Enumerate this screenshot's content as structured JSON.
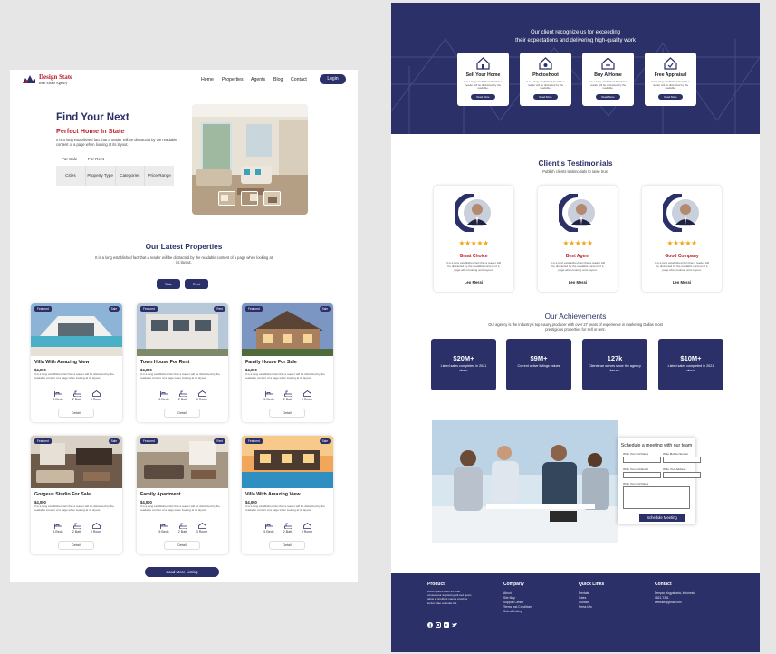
{
  "header": {
    "brand": "Design State",
    "brand_sub": "Real Estate Agency",
    "nav": [
      "Home",
      "Properties",
      "Agents",
      "Blog",
      "Contact"
    ],
    "login": "Login"
  },
  "hero": {
    "title": "Find Your Next",
    "subtitle": "Perfect Home In State",
    "desc": "It is a long established fact that a reader will be distracted by the readable content of a page when looking at its layout.",
    "tabs": [
      "For Sale",
      "For Rent"
    ],
    "filters": [
      "Cities",
      "Property Type",
      "Categories",
      "Price Range"
    ]
  },
  "latest": {
    "title": "Our Latest Properties",
    "desc": "It is a long established fact that a reader will be distracted by the readable content of a page when looking at its layout.",
    "buttons": [
      "Sale",
      "Rent"
    ],
    "load_more": "Load More Listing"
  },
  "cards": [
    {
      "title": "Villa With Amazing View",
      "price": "$4,000",
      "badge": "Featured",
      "tag": "Sale"
    },
    {
      "title": "Town House For Rent",
      "price": "$4,000",
      "badge": "Featured",
      "tag": "Rent"
    },
    {
      "title": "Family House For Sale",
      "price": "$4,000",
      "badge": "Featured",
      "tag": "Sale"
    },
    {
      "title": "Gorgeus Studio For Sale",
      "price": "$4,000",
      "badge": "Featured",
      "tag": "Sale"
    },
    {
      "title": "Family Apartment",
      "price": "$4,000",
      "badge": "Featured",
      "tag": "Rent"
    },
    {
      "title": "Villa With Amazing View",
      "price": "$4,000",
      "badge": "Featured",
      "tag": "Sale"
    }
  ],
  "card_common": {
    "desc": "It is a long established fact that a reader will be distracted by the readable content of a page when looking at its layout.",
    "beds": "5 Beds",
    "bath": "2 Bath",
    "room": "3 Room",
    "detail": "Detail"
  },
  "services": {
    "title_line1": "Our client recognize us for exceeding",
    "title_line2": "their expectations and delivering high-quality work",
    "items": [
      "Sell Your Home",
      "Photoshoot",
      "Buy A Home",
      "Free Appraisal"
    ],
    "desc": "It is a long established fact that a reader will be distracted by the readable.",
    "button": "Read More"
  },
  "testimonials": {
    "title": "Client's Testimonials",
    "subtitle": "Publish clients testimonials to raise trust",
    "items": [
      {
        "title": "Great Choice",
        "name": "Leo Messi"
      },
      {
        "title": "Best Agent",
        "name": "Leo Messi"
      },
      {
        "title": "Good Company",
        "name": "Leo Messi"
      }
    ],
    "desc": "It is a long established fact that a reader will be distracted by the readable content of a page when looking at its layout.",
    "stars": "★★★★★",
    "rating": 5
  },
  "achievements": {
    "title": "Our Achievements",
    "desc": "Our agency is the industry's top luxury producer with over 27 years of experience in marketing Dallas most prestigious properties for sell or rent.",
    "items": [
      {
        "value": "$20M+",
        "label": "Listed sales completed in 2021 alone"
      },
      {
        "value": "$9M+",
        "label": "Current active listings values"
      },
      {
        "value": "127k",
        "label": "Clients we serves since the agency launch"
      },
      {
        "value": "$10M+",
        "label": "Listed sales completed in 2021 alone"
      }
    ]
  },
  "meeting": {
    "title": "Schedule a meeting with our team",
    "labels": [
      "Write Your Full Name",
      "Write Mobile Number",
      "Write Your Full Email",
      "Write Your Address",
      "Write Your Full Name"
    ],
    "button": "Schedule Meeting"
  },
  "footer": {
    "product": {
      "title": "Product",
      "text": "Lorem ipsum dolor sit amet consectetur adipiscing elit sed quam tellus et tincidunt mauris a lacinia lectus vitae vehicula nisl."
    },
    "company": {
      "title": "Company",
      "items": [
        "About",
        "Site Map",
        "Support Center",
        "Terms and Conditions",
        "Submit Listing"
      ]
    },
    "quick": {
      "title": "Quick Links",
      "items": [
        "Rentals",
        "Sales",
        "Contact",
        "Press Info"
      ]
    },
    "contact": {
      "title": "Contact",
      "items": [
        "Denpar, Yogyakarta, Indonesia",
        "0821-7361",
        "website@gmail.com"
      ]
    }
  },
  "colors": {
    "navy": "#2b3068",
    "red": "#b71c2a",
    "star": "#f0a818"
  }
}
